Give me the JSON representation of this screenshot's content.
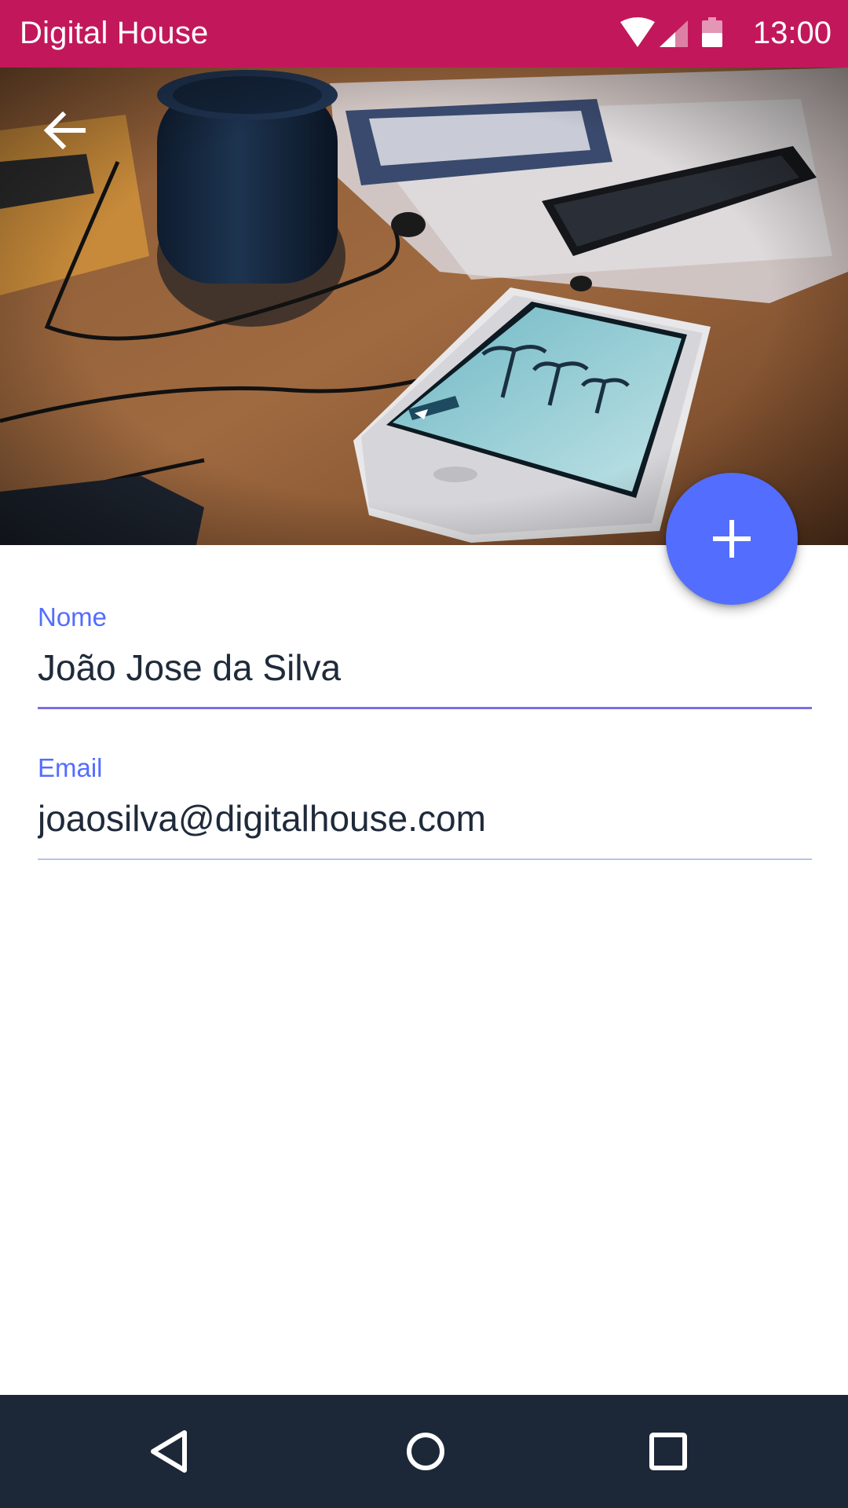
{
  "status_bar": {
    "title": "Digital House",
    "time": "13:00",
    "icons": [
      "wifi-icon",
      "signal-icon",
      "battery-icon"
    ],
    "background_color": "#c2185b"
  },
  "header": {
    "back_icon": "arrow-back-icon",
    "hero_image": "desk with speaker, earphones, calculator and smartphones"
  },
  "fab": {
    "icon": "plus-icon",
    "color": "#536dfe"
  },
  "form": {
    "nome": {
      "label": "Nome",
      "value": "João Jose da Silva"
    },
    "email": {
      "label": "Email",
      "value": "joaosilva@digitalhouse.com"
    }
  },
  "nav_bar": {
    "icons": [
      "nav-back-icon",
      "nav-home-icon",
      "nav-recents-icon"
    ],
    "background_color": "#1c2738"
  },
  "colors": {
    "accent": "#536dfe",
    "text_primary": "#1f2a3a"
  }
}
